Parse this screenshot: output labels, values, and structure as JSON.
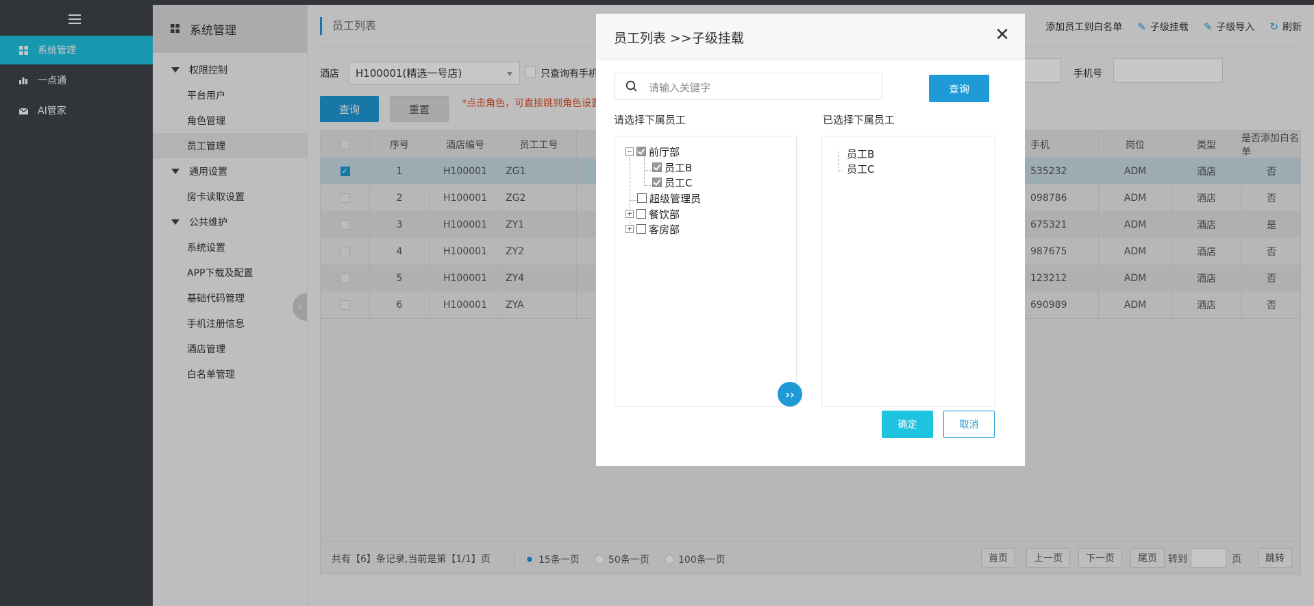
{
  "sidebar": {
    "items": [
      {
        "label": "系统管理",
        "icon": "grid-icon",
        "active": true
      },
      {
        "label": "一点通",
        "icon": "bar-chart-icon",
        "active": false
      },
      {
        "label": "AI管家",
        "icon": "mail-icon",
        "active": false
      }
    ]
  },
  "menu2": {
    "title": "系统管理",
    "groups": [
      {
        "label": "权限控制",
        "items": [
          "平台用户",
          "角色管理",
          "员工管理"
        ]
      },
      {
        "label": "通用设置",
        "items": [
          "房卡读取设置"
        ]
      },
      {
        "label": "公共维护",
        "items": [
          "系统设置",
          "APP下载及配置",
          "基础代码管理",
          "手机注册信息",
          "酒店管理",
          "白名单管理"
        ]
      }
    ],
    "active_item": "员工管理"
  },
  "main": {
    "title": "员工列表",
    "toolbar": {
      "whitelist": "添加员工到白名单",
      "mount": "子级挂载",
      "import": "子级导入",
      "refresh": "刷新"
    },
    "filters": {
      "hotel_label": "酒店",
      "hotel_value": "H100001(精选一号店)",
      "only_query_label": "只查询有手机",
      "phone_label": "手机号"
    },
    "query_button": "查询",
    "reset_button": "重置",
    "hint": "*点击角色，可直接跳到角色设置",
    "table": {
      "headers": {
        "no": "序号",
        "hotel": "酒店编号",
        "emp": "员工工号",
        "phone": "手机",
        "post": "岗位",
        "type": "类型",
        "white": "是否添加白名单"
      },
      "rows": [
        {
          "no": "1",
          "hotel": "H100001",
          "emp": "ZG1",
          "phone": "535232",
          "post": "ADM",
          "type": "酒店",
          "white": "否",
          "checked": true
        },
        {
          "no": "2",
          "hotel": "H100001",
          "emp": "ZG2",
          "phone": "098786",
          "post": "ADM",
          "type": "酒店",
          "white": "否",
          "checked": false
        },
        {
          "no": "3",
          "hotel": "H100001",
          "emp": "ZY1",
          "phone": "675321",
          "post": "ADM",
          "type": "酒店",
          "white": "是",
          "checked": false
        },
        {
          "no": "4",
          "hotel": "H100001",
          "emp": "ZY2",
          "phone": "987675",
          "post": "ADM",
          "type": "酒店",
          "white": "否",
          "checked": false
        },
        {
          "no": "5",
          "hotel": "H100001",
          "emp": "ZY4",
          "phone": "123212",
          "post": "ADM",
          "type": "酒店",
          "white": "否",
          "checked": false
        },
        {
          "no": "6",
          "hotel": "H100001",
          "emp": "ZYA",
          "phone": "690989",
          "post": "ADM",
          "type": "酒店",
          "white": "否",
          "checked": false
        }
      ]
    },
    "footer": {
      "summary": "共有【6】条记录,当前是第【1/1】页",
      "per_page": [
        "15条一页",
        "50条一页",
        "100条一页"
      ],
      "first": "首页",
      "prev": "上一页",
      "next": "下一页",
      "last": "尾页",
      "goto_label": "转到",
      "page_unit": "页",
      "jump": "跳转"
    }
  },
  "modal": {
    "title": "员工列表 >>子级挂载",
    "search_placeholder": "请输入关键字",
    "query_button": "查询",
    "left_label": "请选择下属员工",
    "right_label": "已选择下属员工",
    "tree": {
      "dept1": "前厅部",
      "emp_b": "员工B",
      "emp_c": "员工C",
      "super_admin": "超级管理员",
      "dept2": "餐饮部",
      "dept3": "客房部"
    },
    "selected": [
      "员工B",
      "员工C"
    ],
    "move_symbol": "››",
    "ok_button": "确定",
    "cancel_button": "取消"
  }
}
